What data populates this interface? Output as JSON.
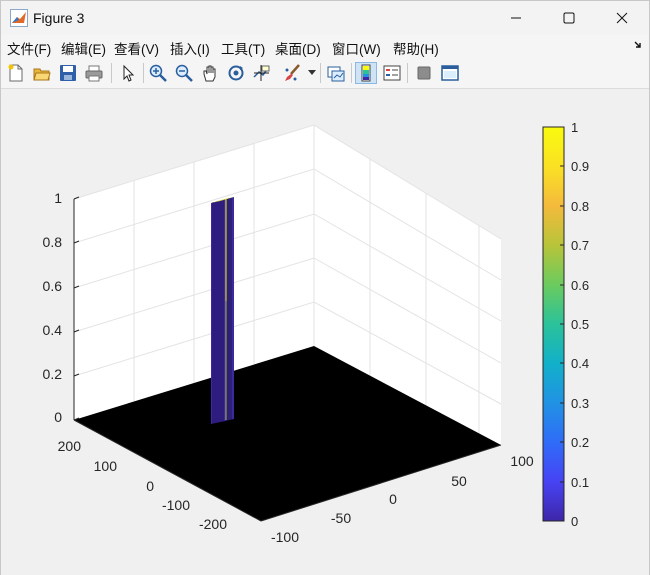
{
  "window": {
    "title": "Figure 3"
  },
  "menu": [
    "文件(F)",
    "编辑(E)",
    "查看(V)",
    "插入(I)",
    "工具(T)",
    "桌面(D)",
    "窗口(W)",
    "帮助(H)"
  ],
  "toolbar": [
    {
      "icon": "new-figure-icon"
    },
    {
      "icon": "open-file-icon"
    },
    {
      "icon": "save-icon"
    },
    {
      "icon": "print-icon"
    },
    {
      "icon": "edit-plot-arrow-icon"
    },
    {
      "icon": "zoom-in-icon"
    },
    {
      "icon": "zoom-out-icon"
    },
    {
      "icon": "pan-hand-icon"
    },
    {
      "icon": "rotate-3d-icon"
    },
    {
      "icon": "data-cursor-icon"
    },
    {
      "icon": "brush-icon"
    },
    {
      "icon": "link-plot-icon"
    },
    {
      "icon": "colorbar-icon"
    },
    {
      "icon": "legend-icon"
    },
    {
      "icon": "hide-plot-tools-icon"
    },
    {
      "icon": "show-plot-tools-icon"
    }
  ],
  "plot": {
    "z_ticks": [
      "0",
      "0.2",
      "0.4",
      "0.6",
      "0.8",
      "1"
    ],
    "y_ticks": [
      "200",
      "100",
      "0",
      "-100",
      "-200"
    ],
    "x_ticks": [
      "-100",
      "-50",
      "0",
      "50",
      "100"
    ]
  },
  "colorbar": {
    "ticks": [
      "0",
      "0.1",
      "0.2",
      "0.3",
      "0.4",
      "0.5",
      "0.6",
      "0.7",
      "0.8",
      "0.9",
      "1"
    ],
    "colormap": [
      "#3e26a8",
      "#4743f4",
      "#2f6cf8",
      "#2192e4",
      "#12b0c9",
      "#2bc29a",
      "#6bcb5e",
      "#b8c43a",
      "#f4ba3c",
      "#fae124",
      "#f9fb0e"
    ]
  }
}
